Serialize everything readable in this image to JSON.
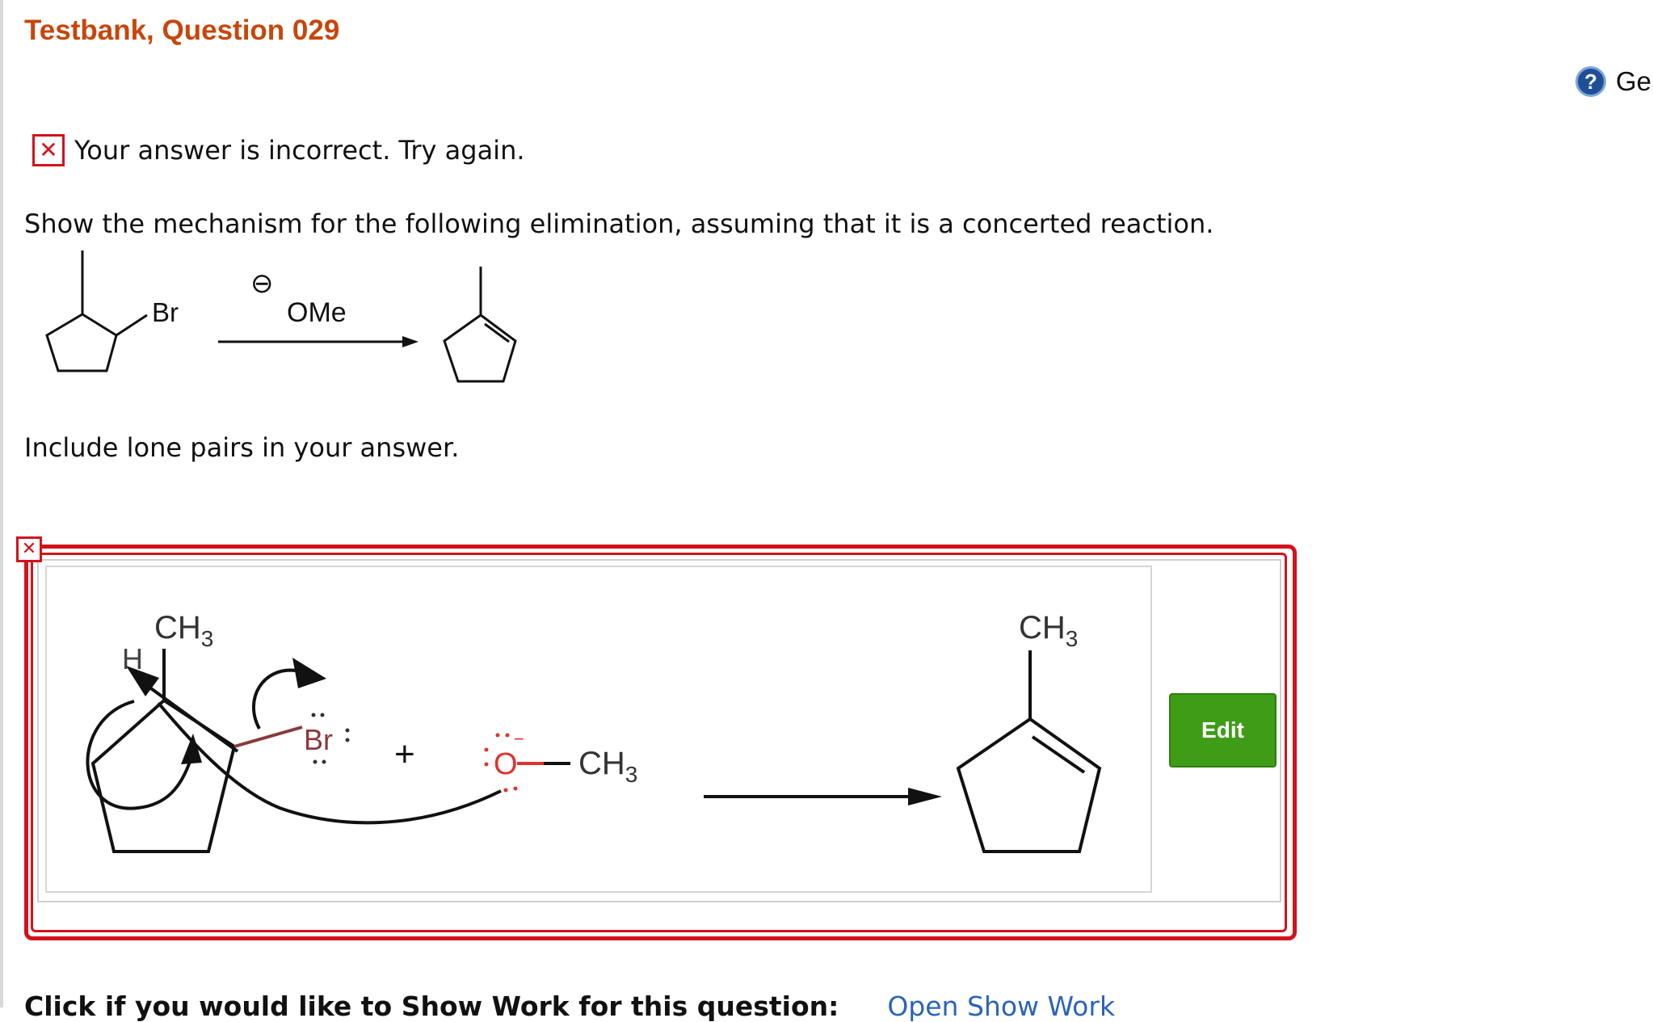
{
  "header": {
    "title": "Testbank, Question 029"
  },
  "help": {
    "icon": "help-icon",
    "text": "Ge"
  },
  "feedback": {
    "icon": "incorrect-icon",
    "message": "Your answer is incorrect.  Try again."
  },
  "question": {
    "prompt": "Show the mechanism for the following elimination, assuming that it is a concerted reaction.",
    "reaction": {
      "leaving_group": "Br",
      "reagent": "OMe",
      "reagent_charge": "⊖"
    },
    "instruction": "Include lone pairs in your answer."
  },
  "answer": {
    "status_icon": "incorrect-icon",
    "edit_label": "Edit",
    "drawing": {
      "h_label": "H",
      "methyl_label_left": "CH",
      "methyl_sub_left": "3",
      "br_label": "Br",
      "plus": "+",
      "o_label": "O",
      "o_charge": "−",
      "och3_label": "CH",
      "och3_sub": "3",
      "methyl_label_right": "CH",
      "methyl_sub_right": "3"
    }
  },
  "footer": {
    "text": "Click if you would like to Show Work for this question:",
    "link_label": "Open Show Work"
  },
  "colors": {
    "title": "#c7460b",
    "error": "#d3121c",
    "edit_button": "#3f9c16",
    "help_icon": "#1f4f97"
  }
}
